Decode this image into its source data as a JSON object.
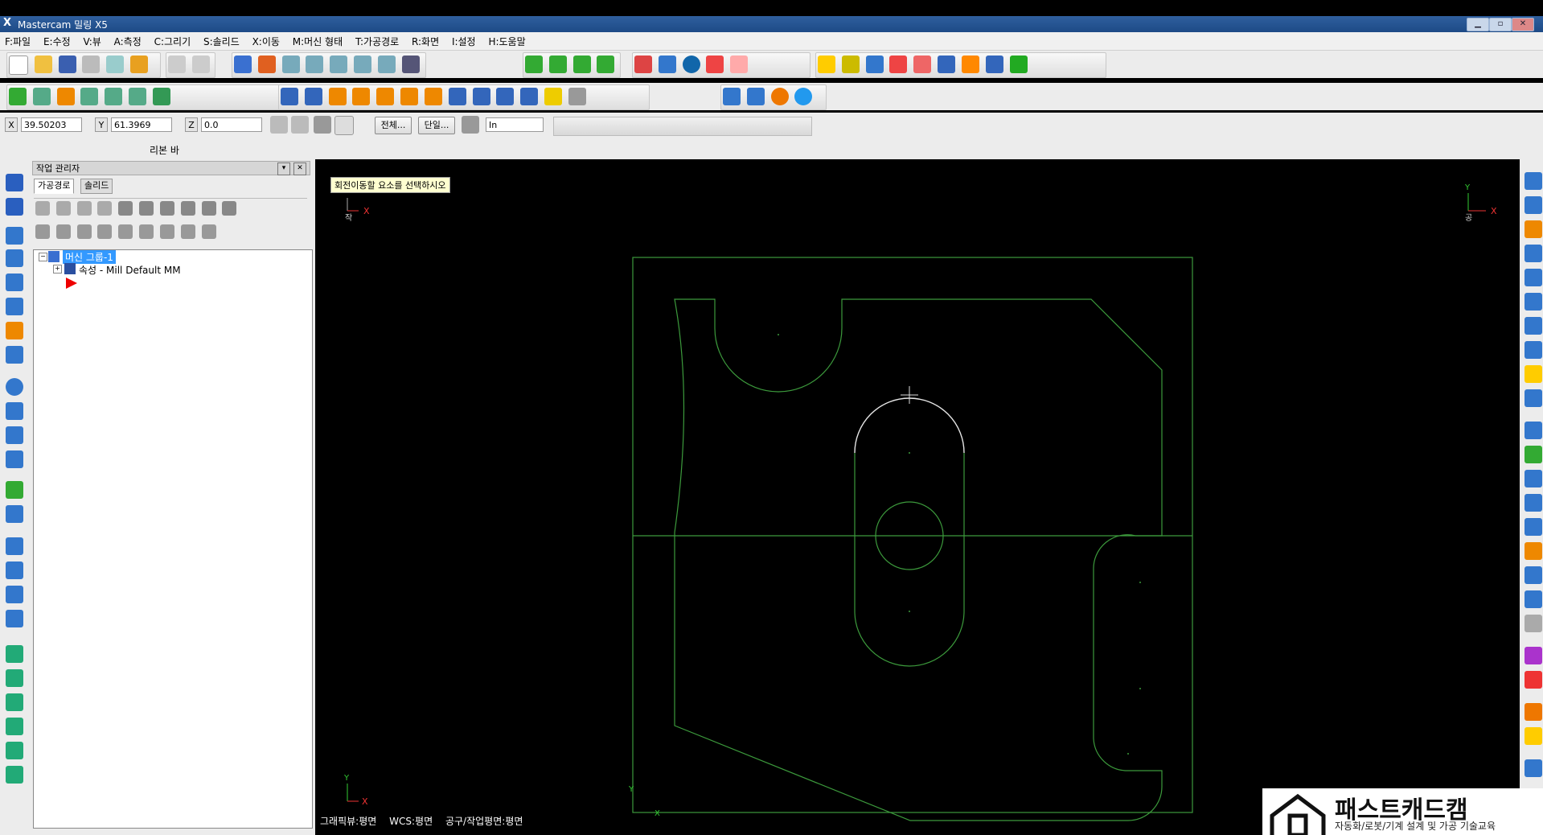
{
  "window": {
    "title": "Mastercam 밀링 X5"
  },
  "menu": [
    "F:파일",
    "E:수정",
    "V:뷰",
    "A:측정",
    "C:그리기",
    "S:솔리드",
    "X:이동",
    "M:머신 형태",
    "T:가공경로",
    "R:화면",
    "I:설정",
    "H:도움말"
  ],
  "coords": {
    "x_label": "X",
    "x_value": "39.50203",
    "y_label": "Y",
    "y_value": "61.3969",
    "z_label": "Z",
    "z_value": "0.0",
    "all_button": "전체...",
    "single_button": "단일...",
    "unit_select": "In"
  },
  "ribbon": {
    "label": "리본 바"
  },
  "operations_manager": {
    "title": "작업 관리자",
    "tabs": [
      "가공경로",
      "솔리드"
    ],
    "tree": {
      "group": "머신 그룹-1",
      "properties": "속성 - Mill Default MM"
    }
  },
  "viewport": {
    "prompt": "회전이동할 요소를 선택하시오",
    "top_axis_label": "작",
    "axis_x": "X",
    "axis_y": "Y",
    "right_axis_label": "공"
  },
  "status": {
    "graphic_view": "그래픽뷰:평면",
    "wcs": "WCS:평면",
    "tool_plane": "공구/작업평면:평면"
  },
  "brand": {
    "name": "패스트캐드캠",
    "tagline": "자동화/로봇/기계 설계 및 가공 기술교육"
  },
  "colors": {
    "geometry": "#3c9a3c",
    "selected": "#e6e6e6",
    "viewport": "#000000"
  }
}
